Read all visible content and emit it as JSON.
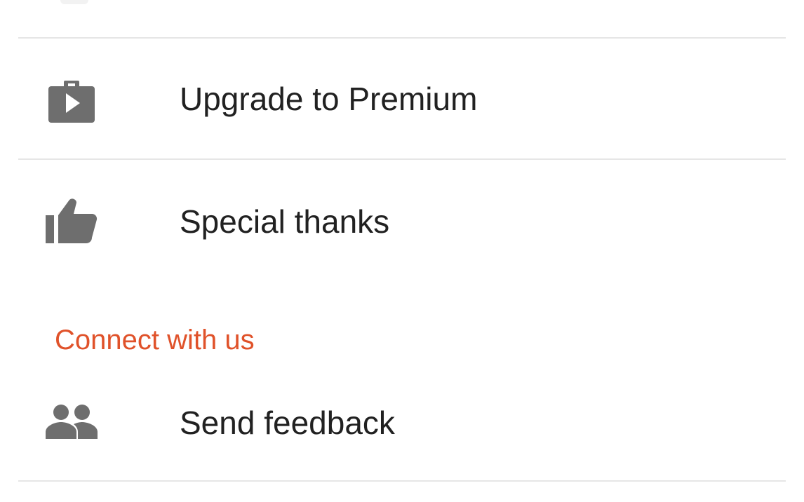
{
  "menu": {
    "items": [
      {
        "label": "Upgrade to Premium",
        "icon": "premium-briefcase-play-icon"
      },
      {
        "label": "Special thanks",
        "icon": "thumbs-up-icon"
      }
    ],
    "connect_section": {
      "header": "Connect with us",
      "items": [
        {
          "label": "Send feedback",
          "icon": "people-icon"
        }
      ]
    }
  },
  "colors": {
    "accent": "#e0522a",
    "icon": "#6e6e6e",
    "text": "#212121",
    "divider": "#e6e6e6"
  }
}
